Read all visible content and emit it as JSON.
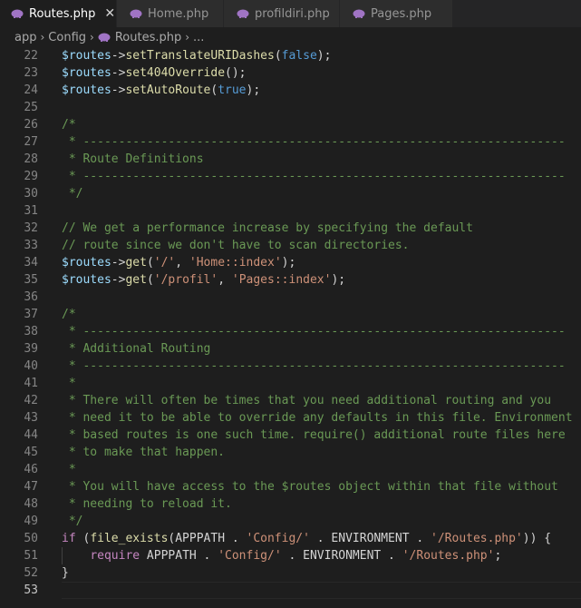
{
  "tabs": [
    {
      "label": "Routes.php",
      "active": true,
      "close": "✕"
    },
    {
      "label": "Home.php",
      "active": false
    },
    {
      "label": "profildiri.php",
      "active": false
    },
    {
      "label": "Pages.php",
      "active": false
    }
  ],
  "breadcrumb": {
    "parts": [
      "app",
      "Config",
      "Routes.php",
      "..."
    ]
  },
  "colors": {
    "php_icon": "#a074c4",
    "comment": "#6a9955",
    "variable": "#9cdcfe",
    "function": "#dcdcaa",
    "keyword": "#569cd6",
    "string": "#ce9178",
    "control": "#c586c0"
  },
  "editor": {
    "current_line": "53",
    "lines": [
      {
        "n": "22",
        "tokens": [
          [
            "v",
            "$routes"
          ],
          [
            "p",
            "->"
          ],
          [
            "f",
            "setTranslateURIDashes"
          ],
          [
            "p",
            "("
          ],
          [
            "k",
            "false"
          ],
          [
            "p",
            ");"
          ]
        ]
      },
      {
        "n": "23",
        "tokens": [
          [
            "v",
            "$routes"
          ],
          [
            "p",
            "->"
          ],
          [
            "f",
            "set404Override"
          ],
          [
            "p",
            "();"
          ]
        ]
      },
      {
        "n": "24",
        "tokens": [
          [
            "v",
            "$routes"
          ],
          [
            "p",
            "->"
          ],
          [
            "f",
            "setAutoRoute"
          ],
          [
            "p",
            "("
          ],
          [
            "k",
            "true"
          ],
          [
            "p",
            ");"
          ]
        ]
      },
      {
        "n": "25",
        "tokens": []
      },
      {
        "n": "26",
        "tokens": [
          [
            "c",
            "/*"
          ]
        ]
      },
      {
        "n": "27",
        "tokens": [
          [
            "c",
            " * --------------------------------------------------------------------"
          ]
        ]
      },
      {
        "n": "28",
        "tokens": [
          [
            "c",
            " * Route Definitions"
          ]
        ]
      },
      {
        "n": "29",
        "tokens": [
          [
            "c",
            " * --------------------------------------------------------------------"
          ]
        ]
      },
      {
        "n": "30",
        "tokens": [
          [
            "c",
            " */"
          ]
        ]
      },
      {
        "n": "31",
        "tokens": []
      },
      {
        "n": "32",
        "tokens": [
          [
            "c",
            "// We get a performance increase by specifying the default"
          ]
        ]
      },
      {
        "n": "33",
        "tokens": [
          [
            "c",
            "// route since we don't have to scan directories."
          ]
        ]
      },
      {
        "n": "34",
        "tokens": [
          [
            "v",
            "$routes"
          ],
          [
            "p",
            "->"
          ],
          [
            "f",
            "get"
          ],
          [
            "p",
            "("
          ],
          [
            "s",
            "'/'"
          ],
          [
            "p",
            ", "
          ],
          [
            "s",
            "'Home::index'"
          ],
          [
            "p",
            ");"
          ]
        ]
      },
      {
        "n": "35",
        "tokens": [
          [
            "v",
            "$routes"
          ],
          [
            "p",
            "->"
          ],
          [
            "f",
            "get"
          ],
          [
            "p",
            "("
          ],
          [
            "s",
            "'/profil'"
          ],
          [
            "p",
            ", "
          ],
          [
            "s",
            "'Pages::index'"
          ],
          [
            "p",
            ");"
          ]
        ]
      },
      {
        "n": "36",
        "tokens": []
      },
      {
        "n": "37",
        "tokens": [
          [
            "c",
            "/*"
          ]
        ]
      },
      {
        "n": "38",
        "tokens": [
          [
            "c",
            " * --------------------------------------------------------------------"
          ]
        ]
      },
      {
        "n": "39",
        "tokens": [
          [
            "c",
            " * Additional Routing"
          ]
        ]
      },
      {
        "n": "40",
        "tokens": [
          [
            "c",
            " * --------------------------------------------------------------------"
          ]
        ]
      },
      {
        "n": "41",
        "tokens": [
          [
            "c",
            " *"
          ]
        ]
      },
      {
        "n": "42",
        "tokens": [
          [
            "c",
            " * There will often be times that you need additional routing and you"
          ]
        ]
      },
      {
        "n": "43",
        "tokens": [
          [
            "c",
            " * need it to be able to override any defaults in this file. Environment"
          ]
        ]
      },
      {
        "n": "44",
        "tokens": [
          [
            "c",
            " * based routes is one such time. require() additional route files here"
          ]
        ]
      },
      {
        "n": "45",
        "tokens": [
          [
            "c",
            " * to make that happen."
          ]
        ]
      },
      {
        "n": "46",
        "tokens": [
          [
            "c",
            " *"
          ]
        ]
      },
      {
        "n": "47",
        "tokens": [
          [
            "c",
            " * You will have access to the $routes object within that file without"
          ]
        ]
      },
      {
        "n": "48",
        "tokens": [
          [
            "c",
            " * needing to reload it."
          ]
        ]
      },
      {
        "n": "49",
        "tokens": [
          [
            "c",
            " */"
          ]
        ]
      },
      {
        "n": "50",
        "tokens": [
          [
            "ctl",
            "if"
          ],
          [
            "p",
            " ("
          ],
          [
            "f",
            "file_exists"
          ],
          [
            "p",
            "(APPPATH . "
          ],
          [
            "s",
            "'Config/'"
          ],
          [
            "p",
            " . ENVIRONMENT . "
          ],
          [
            "s",
            "'/Routes.php'"
          ],
          [
            "p",
            ")) {"
          ]
        ]
      },
      {
        "n": "51",
        "tokens": [
          [
            "p",
            "    "
          ],
          [
            "ctl",
            "require"
          ],
          [
            "p",
            " APPPATH . "
          ],
          [
            "s",
            "'Config/'"
          ],
          [
            "p",
            " . ENVIRONMENT . "
          ],
          [
            "s",
            "'/Routes.php'"
          ],
          [
            "p",
            ";"
          ]
        ]
      },
      {
        "n": "52",
        "tokens": [
          [
            "p",
            "}"
          ]
        ]
      },
      {
        "n": "53",
        "tokens": []
      }
    ]
  }
}
